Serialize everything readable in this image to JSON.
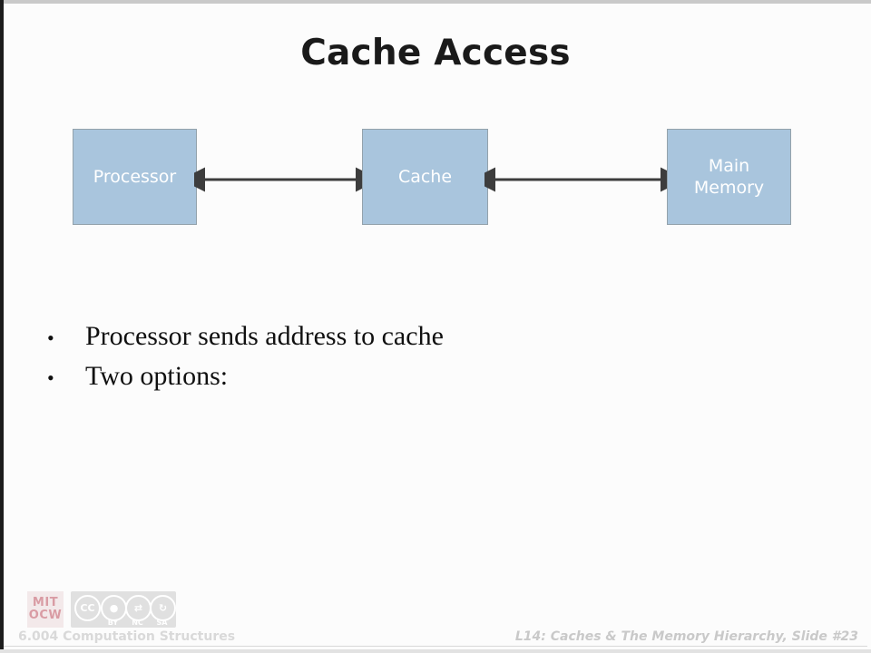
{
  "slide": {
    "title": "Cache Access",
    "background_color": "#fcfcfc",
    "box_fill_color": "#a9c5dd",
    "box_border_color": "#93a2ab",
    "box_text_color": "#ffffff",
    "arrow_color": "#3d3d3d"
  },
  "diagram": {
    "boxes": [
      {
        "id": "processor",
        "label": "Processor"
      },
      {
        "id": "cache",
        "label": "Cache"
      },
      {
        "id": "main-memory",
        "label_line1": "Main",
        "label_line2": "Memory"
      }
    ],
    "arrows": [
      {
        "id": "processor-cache",
        "direction": "bidirectional"
      },
      {
        "id": "cache-main-memory",
        "direction": "bidirectional"
      }
    ]
  },
  "bullets": {
    "marker": "•",
    "items": [
      "Processor sends address to cache",
      "Two options:"
    ]
  },
  "footer": {
    "course": "6.004 Computation Structures",
    "lecture": "L14: Caches & The Memory Hierarchy, Slide #23",
    "mit_logo": {
      "line1": "MIT",
      "line2": "OCW"
    },
    "license": {
      "mark": "CC",
      "terms": [
        "BY",
        "NC",
        "SA"
      ]
    }
  }
}
